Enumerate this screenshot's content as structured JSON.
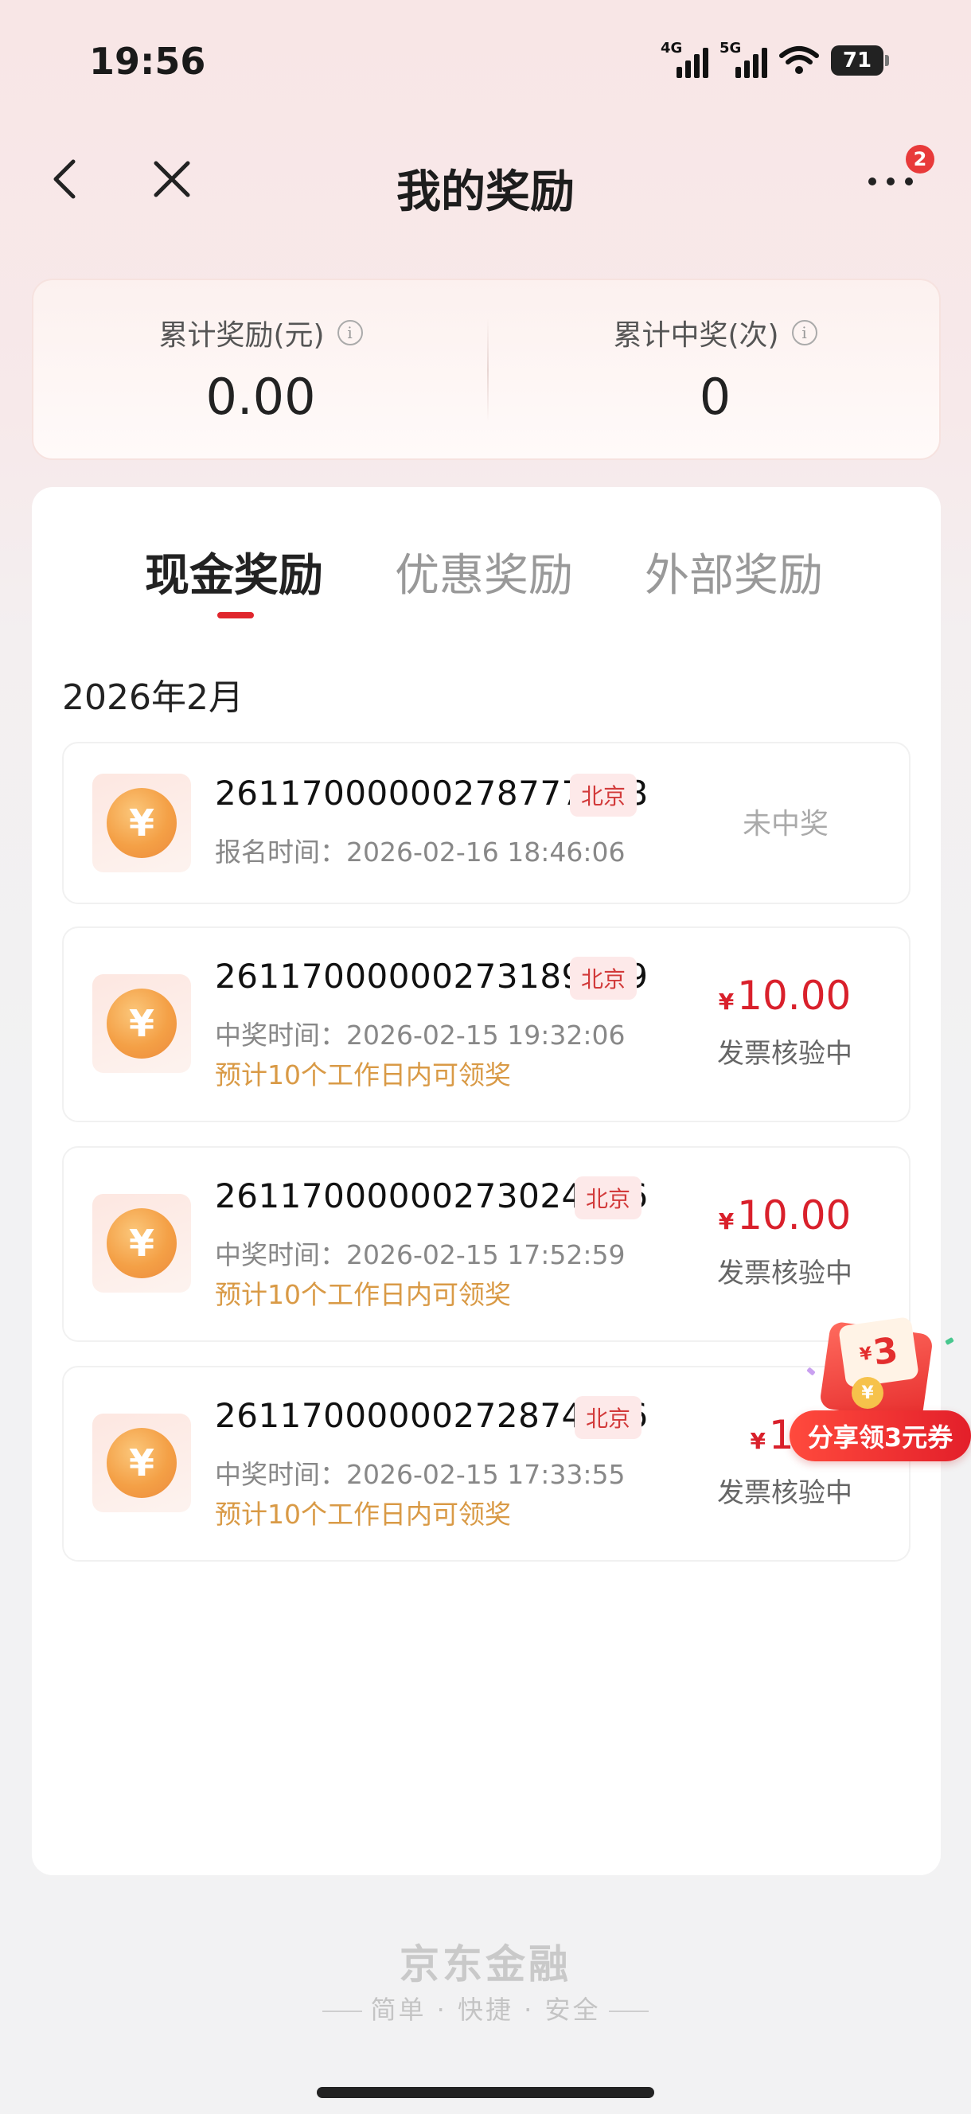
{
  "status_bar": {
    "time": "19:56",
    "net1": "4G",
    "net2": "5G",
    "battery": "71"
  },
  "nav": {
    "title": "我的奖励",
    "badge": "2",
    "back_icon": "chevron-left-icon",
    "close_icon": "close-icon",
    "more_icon": "more-icon"
  },
  "summary": {
    "total_reward_label": "累计奖励(元)",
    "total_reward_value": "0.00",
    "total_wins_label": "累计中奖(次)",
    "total_wins_value": "0"
  },
  "tabs": [
    {
      "label": "现金奖励",
      "active": true
    },
    {
      "label": "优惠奖励",
      "active": false
    },
    {
      "label": "外部奖励",
      "active": false
    }
  ],
  "month": "2026年2月",
  "items": [
    {
      "id": "26117000000278777698",
      "city": "北京",
      "time": "报名时间：2026-02-16 18:46:06",
      "note": "",
      "status": "未中奖",
      "amount": "",
      "sub": ""
    },
    {
      "id": "26117000000273189699",
      "city": "北京",
      "time": "中奖时间：2026-02-15 19:32:06",
      "note": "预计10个工作日内可领奖",
      "status": "",
      "amount": "10.00",
      "sub": "发票核验中"
    },
    {
      "id": "26117000000273024306",
      "city": "北京",
      "time": "中奖时间：2026-02-15 17:52:59",
      "note": "预计10个工作日内可领奖",
      "status": "",
      "amount": "10.00",
      "sub": "发票核验中"
    },
    {
      "id": "26117000000272874906",
      "city": "北京",
      "time": "中奖时间：2026-02-15 17:33:55",
      "note": "预计10个工作日内可领奖",
      "status": "",
      "amount": "10",
      "sub": "发票核验中"
    }
  ],
  "currency_symbol": "¥",
  "promo": {
    "card_value": "3",
    "button": "分享领3元券"
  },
  "footer": {
    "brand": "京东金融",
    "slogan": "简单 · 快捷 · 安全"
  },
  "colors": {
    "accent": "#e0262d",
    "note": "#d99a46",
    "promo": "#e31f2a"
  }
}
